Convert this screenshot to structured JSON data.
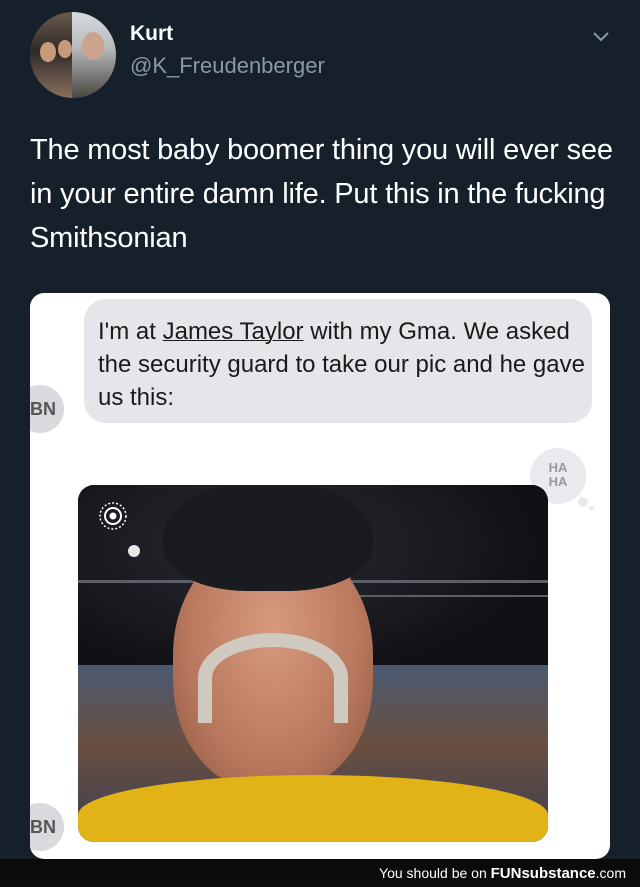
{
  "tweet": {
    "display_name": "Kurt",
    "handle": "@K_Freudenberger",
    "text": "The most baby boomer thing you will ever see in your entire damn life. Put this in the fucking Smithsonian",
    "menu_icon": "chevron-down-icon"
  },
  "screenshot": {
    "message_before": "I'm at ",
    "message_link": "James Taylor",
    "message_after": " with my Gma. We asked the security guard to take our pic and he gave us this:",
    "sender_initials": "BN",
    "reaction": "HA HA",
    "reaction_line1": "HA",
    "reaction_line2": "HA",
    "photo_icon": "live-photo-icon"
  },
  "watermark": {
    "prefix": "You should be on ",
    "brand_bold": "FUN",
    "brand_rest": "substance",
    "suffix": ".com"
  },
  "colors": {
    "background": "#15202b",
    "handle": "#8899a6",
    "bubble": "#e5e5ea",
    "shirt": "#e2b317"
  }
}
